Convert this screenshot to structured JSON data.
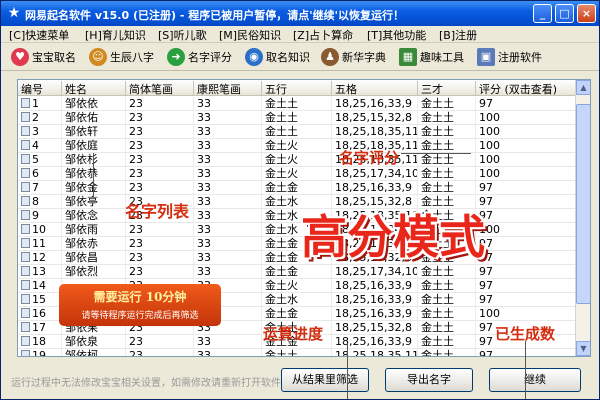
{
  "window": {
    "title": "网易起名软件 v15.0 (已注册) - 程序已被用户暂停，请点'继续'以恢复运行！",
    "minimize_glyph": "_",
    "maximize_glyph": "□",
    "close_glyph": "×"
  },
  "menu": [
    "[C]快速菜单",
    "[H]育儿知识",
    "[S]听儿歌",
    "[M]民俗知识",
    "[Z]占卜算命",
    "[T]其他功能",
    "[B]注册"
  ],
  "toolbar": [
    {
      "label": "宝宝取名",
      "icon": "heart-icon",
      "color": "#e03a50"
    },
    {
      "label": "生辰八字",
      "icon": "people-icon",
      "color": "#d08a20"
    },
    {
      "label": "名字评分",
      "icon": "arrow-icon",
      "color": "#2aa040"
    },
    {
      "label": "取名知识",
      "icon": "globe-icon",
      "color": "#2a70c8"
    },
    {
      "label": "新华字典",
      "icon": "person-icon",
      "color": "#8a5a30"
    },
    {
      "label": "趣味工具",
      "icon": "windows-icon",
      "color": "#3a8a3a"
    },
    {
      "label": "注册软件",
      "icon": "register-icon",
      "color": "#5a7ab8"
    }
  ],
  "columns": [
    "编号",
    "姓名",
    "简体笔画",
    "康熙笔画",
    "五行",
    "五格",
    "三才",
    "评分 (双击查看)"
  ],
  "rows": [
    [
      "1",
      "邹依依",
      "23",
      "33",
      "金土土",
      "18,25,16,33,9",
      "金土土",
      "97"
    ],
    [
      "2",
      "邹依佑",
      "23",
      "33",
      "金土土",
      "18,25,15,32,8",
      "金土土",
      "100"
    ],
    [
      "3",
      "邹依轩",
      "23",
      "33",
      "金土土",
      "18,25,18,35,11",
      "金土土",
      "100"
    ],
    [
      "4",
      "邹依庭",
      "23",
      "33",
      "金土火",
      "18,25,18,35,11",
      "金土土",
      "100"
    ],
    [
      "5",
      "邹依杉",
      "23",
      "33",
      "金土火",
      "18,25,18,35,11",
      "金土土",
      "100"
    ],
    [
      "6",
      "邹依恭",
      "23",
      "33",
      "金土火",
      "18,25,17,34,10",
      "金土土",
      "100"
    ],
    [
      "7",
      "邹依金",
      "23",
      "33",
      "金土金",
      "18,25,16,33,9",
      "金土土",
      "97"
    ],
    [
      "8",
      "邹依亭",
      "23",
      "33",
      "金土水",
      "18,25,15,32,8",
      "金土土",
      "97"
    ],
    [
      "9",
      "邹依念",
      "23",
      "33",
      "金土水",
      "18,25,18,35,11",
      "金土土",
      "97"
    ],
    [
      "10",
      "邹依雨",
      "23",
      "33",
      "金土水",
      "18,25,17,34,10",
      "金土土",
      "100"
    ],
    [
      "11",
      "邹依赤",
      "23",
      "33",
      "金土金",
      "18,25,16,33,9",
      "金土土",
      "97"
    ],
    [
      "12",
      "邹依昌",
      "23",
      "33",
      "金土金",
      "18,25,15,32,8",
      "金土土",
      "97"
    ],
    [
      "13",
      "邹依烈",
      "23",
      "33",
      "金土金",
      "18,25,17,34,10",
      "金土土",
      "97"
    ],
    [
      "14",
      "",
      "23",
      "33",
      "金土火",
      "18,25,16,33,9",
      "金土土",
      "97"
    ],
    [
      "15",
      "",
      "23",
      "33",
      "金土水",
      "18,25,16,33,9",
      "金土土",
      "97"
    ],
    [
      "16",
      "",
      "23",
      "33",
      "金土金",
      "18,25,16,33,9",
      "金土土",
      "100"
    ],
    [
      "17",
      "邹依果",
      "23",
      "33",
      "金土土",
      "18,25,15,32,8",
      "金土土",
      "97"
    ],
    [
      "18",
      "邹依泉",
      "23",
      "33",
      "金土金",
      "18,25,16,33,9",
      "金土土",
      "97"
    ],
    [
      "19",
      "邹依柯",
      "23",
      "33",
      "金土土",
      "18,25,18,35,11",
      "金土土",
      "97"
    ]
  ],
  "status_text": "运行过程中无法修改宝宝相关设置，如需修改请重新打开软件",
  "buttons": {
    "filter": "从结果里筛选",
    "export": "导出名字",
    "continue": "继续"
  },
  "annotations": {
    "name_score": "名字评分",
    "name_list": "名字列表",
    "big_mode": "高分模式",
    "progress": "运算进度",
    "generated_count": "已生成数"
  },
  "banner": {
    "line1": "需要运行 10分钟",
    "line2": "请等待程序运行完成后再筛选"
  }
}
